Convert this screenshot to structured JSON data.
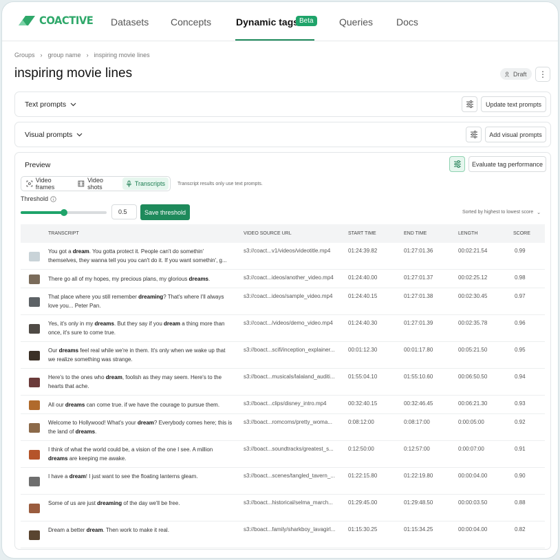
{
  "nav": {
    "brand": "COACTIVE",
    "items": [
      "Datasets",
      "Concepts",
      "Dynamic tags",
      "Queries",
      "Docs"
    ],
    "beta": "Beta"
  },
  "breadcrumb": [
    "Groups",
    "group name",
    "inspiring movie lines"
  ],
  "page": {
    "title": "inspiring movie lines",
    "status": "Draft"
  },
  "text_prompts": {
    "title": "Text prompts",
    "button": "Update text prompts"
  },
  "visual_prompts": {
    "title": "Visual prompts",
    "button": "Add visual prompts"
  },
  "preview": {
    "title": "Preview",
    "evaluate_button": "Evaluate tag performance",
    "tabs": [
      "Video frames",
      "Video shots",
      "Transcripts"
    ],
    "active_tab": "Transcripts",
    "hint": "Transcript results only use text prompts.",
    "threshold_label": "Threshold",
    "threshold_value": "0.5",
    "threshold_fraction": 0.5,
    "save_button": "Save threshold",
    "sort_label": "Sorted by highest to lowest score"
  },
  "table": {
    "headers": [
      "TRANSCRIPT",
      "VIDEO SOURCE URL",
      "START TIME",
      "END TIME",
      "LENGTH",
      "SCORE"
    ],
    "rows": [
      {
        "thumb": "#c9d3d8",
        "segments": [
          [
            "You got a ",
            false
          ],
          [
            "dream",
            true
          ],
          [
            ". You gotta protect it. People can't do somethin' themselves, they wanna tell you you can't do it. If you want somethin', g...",
            false
          ]
        ],
        "url": "s3://coact...v1/videos/videotitle.mp4",
        "start": "01:24:39.82",
        "end": "01:27:01.36",
        "length": "00:02:21.54",
        "score": "0.99"
      },
      {
        "thumb": "#7a6b5a",
        "segments": [
          [
            "There go all of my hopes, my precious plans, my glorious ",
            false
          ],
          [
            "dreams",
            true
          ],
          [
            ".",
            false
          ]
        ],
        "url": "s3://coact...ideos/another_video.mp4",
        "start": "01:24:40.00",
        "end": "01:27:01.37",
        "length": "00:02:25.12",
        "score": "0.98"
      },
      {
        "thumb": "#5d6266",
        "segments": [
          [
            "That place where you still remember ",
            false
          ],
          [
            "dreaming",
            true
          ],
          [
            "? That's where I'll always love you... Peter Pan.",
            false
          ]
        ],
        "url": "s3://coact...ideos/sample_video.mp4",
        "start": "01:24:40.15",
        "end": "01:27:01.38",
        "length": "00:02:30.45",
        "score": "0.97"
      },
      {
        "thumb": "#4f4a45",
        "segments": [
          [
            "Yes, it's only in my ",
            false
          ],
          [
            "dreams",
            true
          ],
          [
            ". But they say if you ",
            false
          ],
          [
            "dream",
            true
          ],
          [
            " a thing more than once, it's sure to come true.",
            false
          ]
        ],
        "url": "s3://coact.../videos/demo_video.mp4",
        "start": "01:24:40.30",
        "end": "01:27:01.39",
        "length": "00:02:35.78",
        "score": "0.96"
      },
      {
        "thumb": "#3b3026",
        "segments": [
          [
            "Our ",
            false
          ],
          [
            "dreams",
            true
          ],
          [
            " feel real while we're in them. It's only when we wake up that we realize something was strange.",
            false
          ]
        ],
        "url": "s3://boact...scifi/inception_explainer...",
        "start": "00:01:12.30",
        "end": "00:01:17.80",
        "length": "00:05:21.50",
        "score": "0.95"
      },
      {
        "thumb": "#6b3b3a",
        "segments": [
          [
            "Here's to the ones who ",
            false
          ],
          [
            "dream",
            true
          ],
          [
            ", foolish as they may seem. Here's to the hearts that ache.",
            false
          ]
        ],
        "url": "s3://boact...musicals/lalaland_auditi...",
        "start": "01:55:04.10",
        "end": "01:55:10.60",
        "length": "00:06:50.50",
        "score": "0.94"
      },
      {
        "thumb": "#b06a2c",
        "segments": [
          [
            "All our ",
            false
          ],
          [
            "dreams",
            true
          ],
          [
            " can come true. if we have the courage to pursue them.",
            false
          ]
        ],
        "url": "s3://boact...clips/disney_intro.mp4",
        "start": "00:32:40.15",
        "end": "00:32:46.45",
        "length": "00:06:21.30",
        "score": "0.93"
      },
      {
        "thumb": "#8c6a4a",
        "segments": [
          [
            "Welcome to Hollywood! What's your ",
            false
          ],
          [
            "dream",
            true
          ],
          [
            "? Everybody comes here; this is the land of ",
            false
          ],
          [
            "dreams",
            true
          ],
          [
            ".",
            false
          ]
        ],
        "url": "s3://boact...romcoms/pretty_woma...",
        "start": "0:08:12:00",
        "end": "0:08:17:00",
        "length": "0:00:05:00",
        "score": "0.92"
      },
      {
        "thumb": "#b5542a",
        "segments": [
          [
            "I think of what the world could be, a vision of the one I see. A million ",
            false
          ],
          [
            "dreams",
            true
          ],
          [
            " are keeping me awake.",
            false
          ]
        ],
        "url": "s3://boact...soundtracks/greatest_s...",
        "start": "0:12:50:00",
        "end": "0:12:57:00",
        "length": "0:00:07:00",
        "score": "0.91"
      },
      {
        "thumb": "#6e6e6e",
        "segments": [
          [
            "I have a ",
            false
          ],
          [
            "dream",
            true
          ],
          [
            "! I just want to see the floating lanterns gleam.",
            false
          ]
        ],
        "url": "s3://boact...scenes/tangled_tavern_...",
        "start": "01:22:15.80",
        "end": "01:22:19.80",
        "length": "00:00:04.00",
        "score": "0.90"
      },
      {
        "thumb": "#9a5c3e",
        "segments": [
          [
            "Some of us are just ",
            false
          ],
          [
            "dreaming",
            true
          ],
          [
            " of the day we'll be free.",
            false
          ]
        ],
        "url": "s3://boact...historical/selma_march...",
        "start": "01:29:45.00",
        "end": "01:29:48.50",
        "length": "00:00:03.50",
        "score": "0.88"
      },
      {
        "thumb": "#5a4530",
        "segments": [
          [
            "Dream a better ",
            false
          ],
          [
            "dream",
            true
          ],
          [
            ". Then work to make it real.",
            false
          ]
        ],
        "url": "s3://boact...family/sharkboy_lavagirl...",
        "start": "01:15:30.25",
        "end": "01:15:34.25",
        "length": "00:00:04.00",
        "score": "0.82"
      }
    ]
  },
  "colors": {
    "brand": "#2fa86a",
    "accent": "#1e8a5b"
  }
}
